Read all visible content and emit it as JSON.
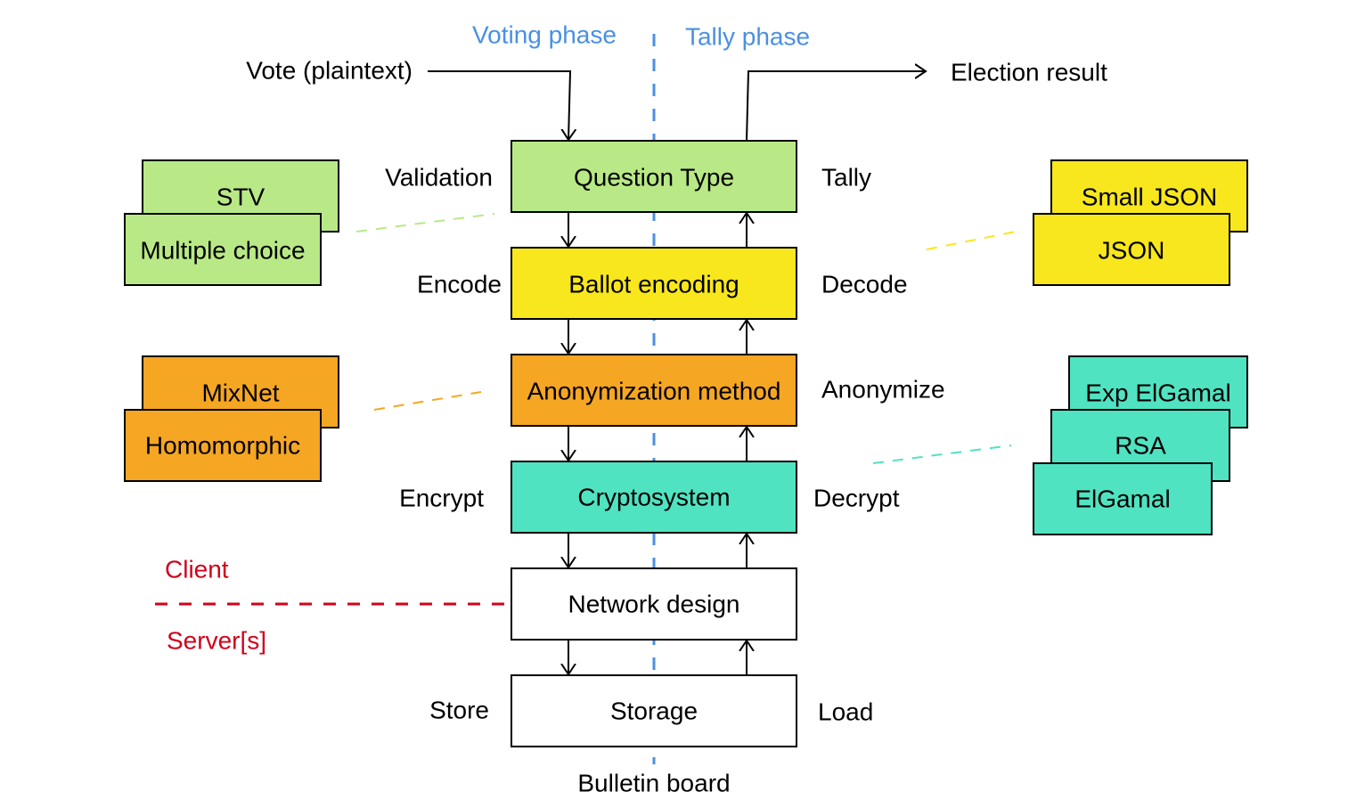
{
  "colors": {
    "green": "#b9e986",
    "yellow": "#f8e71c",
    "orange": "#f5a623",
    "teal": "#50e3c2",
    "phase": "#4a90e2",
    "boundary": "#d0021b"
  },
  "phases": {
    "voting": "Voting phase",
    "tally": "Tally phase"
  },
  "io": {
    "input": "Vote (plaintext)",
    "output": "Election result",
    "bottom": "Bulletin board"
  },
  "layers": [
    {
      "name": "Question Type",
      "down": "Validation",
      "up": "Tally"
    },
    {
      "name": "Ballot encoding",
      "down": "Encode",
      "up": "Decode"
    },
    {
      "name": "Anonymization method",
      "down": "",
      "up": "Anonymize"
    },
    {
      "name": "Cryptosystem",
      "down": "Encrypt",
      "up": "Decrypt"
    },
    {
      "name": "Network design",
      "down": "",
      "up": ""
    },
    {
      "name": "Storage",
      "down": "Store",
      "up": "Load"
    }
  ],
  "options": {
    "question_types": [
      "STV",
      "Multiple choice"
    ],
    "encodings": [
      "Small JSON",
      "JSON"
    ],
    "anonymization": [
      "MixNet",
      "Homomorphic"
    ],
    "cryptosystems": [
      "Exp ElGamal",
      "RSA",
      "ElGamal"
    ]
  },
  "boundary": {
    "above": "Client",
    "below": "Server[s]"
  }
}
